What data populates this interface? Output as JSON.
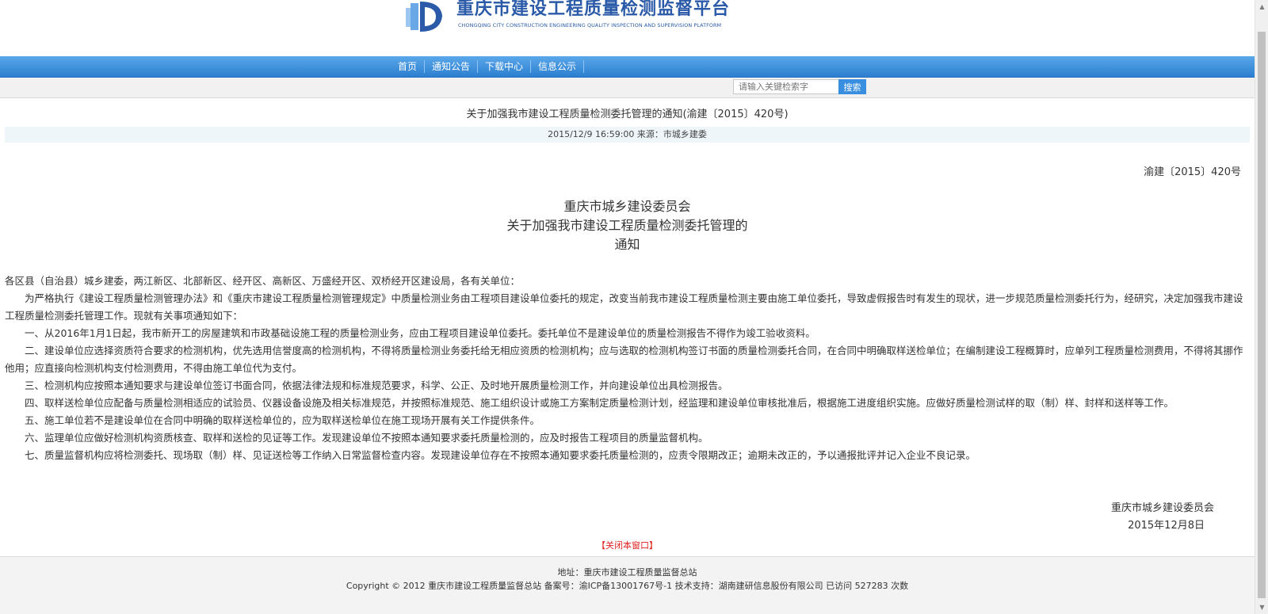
{
  "header": {
    "logo_title": "重庆市建设工程质量检测监督平台",
    "logo_subtitle": "CHONGQING CITY CONSTRUCTION ENGINEERING QUALITY INSPECTION AND SUPERVISION PLATFORM"
  },
  "nav": {
    "items": [
      {
        "label": "首页"
      },
      {
        "label": "通知公告"
      },
      {
        "label": "下载中心"
      },
      {
        "label": "信息公示"
      }
    ]
  },
  "search": {
    "placeholder": "请输入关键检索字",
    "button_label": "搜索"
  },
  "article": {
    "title": "关于加强我市建设工程质量检测委托管理的通知(渝建〔2015〕420号)",
    "meta": "2015/12/9 16:59:00   来源：市城乡建委",
    "doc_number": "渝建〔2015〕420号",
    "heading_line1": "重庆市城乡建设委员会",
    "heading_line2": "关于加强我市建设工程质量检测委托管理的",
    "heading_line3": "通知",
    "salutation": "各区县（自治县）城乡建委，两江新区、北部新区、经开区、高新区、万盛经开区、双桥经开区建设局，各有关单位：",
    "paragraphs": [
      "为严格执行《建设工程质量检测管理办法》和《重庆市建设工程质量检测管理规定》中质量检测业务由工程项目建设单位委托的规定，改变当前我市建设工程质量检测主要由施工单位委托，导致虚假报告时有发生的现状，进一步规范质量检测委托行为，经研究，决定加强我市建设工程质量检测委托管理工作。现就有关事项通知如下：",
      "一、从2016年1月1日起，我市新开工的房屋建筑和市政基础设施工程的质量检测业务，应由工程项目建设单位委托。委托单位不是建设单位的质量检测报告不得作为竣工验收资料。",
      "二、建设单位应选择资质符合要求的检测机构，优先选用信誉度高的检测机构，不得将质量检测业务委托给无相应资质的检测机构；应与选取的检测机构签订书面的质量检测委托合同，在合同中明确取样送检单位；在编制建设工程概算时，应单列工程质量检测费用，不得将其挪作他用；应直接向检测机构支付检测费用，不得由施工单位代为支付。",
      "三、检测机构应按照本通知要求与建设单位签订书面合同，依据法律法规和标准规范要求，科学、公正、及时地开展质量检测工作，并向建设单位出具检测报告。",
      "四、取样送检单位应配备与质量检测相适应的试验员、仪器设备设施及相关标准规范，并按照标准规范、施工组织设计或施工方案制定质量检测计划，经监理和建设单位审核批准后，根据施工进度组织实施。应做好质量检测试样的取（制）样、封样和送样等工作。",
      "五、施工单位若不是建设单位在合同中明确的取样送检单位的，应为取样送检单位在施工现场开展有关工作提供条件。",
      "六、监理单位应做好检测机构资质核查、取样和送检的见证等工作。发现建设单位不按照本通知要求委托质量检测的，应及时报告工程项目的质量监督机构。",
      "七、质量监督机构应将检测委托、现场取（制）样、见证送检等工作纳入日常监督检查内容。发现建设单位存在不按照本通知要求委托质量检测的，应责令限期改正；逾期未改正的，予以通报批评并记入企业不良记录。"
    ],
    "sign_org": "重庆市城乡建设委员会",
    "sign_date": "2015年12月8日",
    "close_label": "【关闭本窗口】"
  },
  "footer": {
    "address": "地址：重庆市建设工程质量监督总站",
    "copyright": "Copyright © 2012 重庆市建设工程质量监督总站 备案号：渝ICP备13001767号-1 技术支持：湖南建研信息股份有限公司 已访问 527283 次数"
  },
  "colors": {
    "nav_blue": "#2c7fd0",
    "brand_blue": "#2a5aa8",
    "close_red": "#e02020",
    "meta_bg": "#eef6f9"
  },
  "icons": {
    "logo": "platform-logo-mark",
    "scroll_up": "scroll-up-arrow-icon",
    "scroll_down": "scroll-down-arrow-icon"
  }
}
